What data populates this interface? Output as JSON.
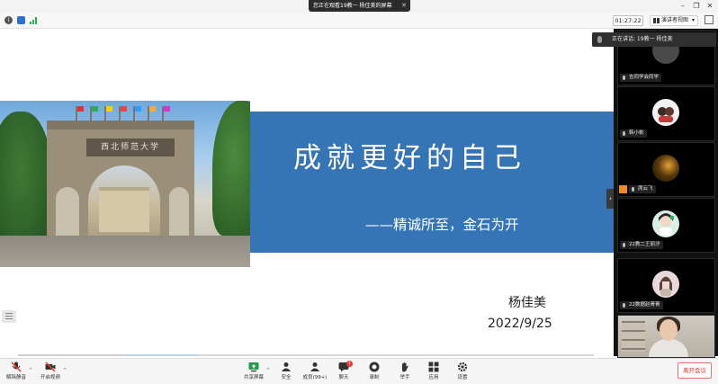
{
  "titlebar": {
    "viewing_label": "您正在观看19教一 杨佳美的屏幕",
    "close_glyph": "✕",
    "minimize_glyph": "–",
    "restore_glyph": "❐",
    "close_window_glyph": "✕"
  },
  "infobar": {
    "timer": "01:27:22",
    "view_button": "演讲者视图",
    "view_caret": "▾"
  },
  "slide": {
    "gate_plaque": "西北师范大学",
    "title": "成就更好的自己",
    "subtitle": "——精诚所至，金石为开",
    "presenter": "杨佳美",
    "date": "2022/9/25",
    "collapse_glyph": "›"
  },
  "right_panel": {
    "speaking_tip": "正在讲话: 19教一 杨佳美",
    "participants": [
      {
        "name": "吉同学会同学",
        "avatar_color": "#5a5a5a"
      },
      {
        "name": "韩小彬",
        "avatar_color": "#f2f2f2"
      },
      {
        "name": "席云飞",
        "avatar_color": "#3a2a10"
      },
      {
        "name": "22教二王丽汐",
        "avatar_color": "#dcefe4"
      },
      {
        "name": "22数据赵菁菁",
        "avatar_color": "#e7d8dc"
      }
    ]
  },
  "toolbar": {
    "mute_label": "解除静音",
    "video_label": "开启视频",
    "share_label": "共享屏幕",
    "security_label": "安全",
    "participants_label": "成员(99+)",
    "chat_label": "聊天",
    "chat_badge": "1",
    "record_label": "录制",
    "raise_hand_label": "举手",
    "apps_label": "应用",
    "settings_label": "设置",
    "leave_label": "离开会议",
    "caret_glyph": "^"
  },
  "colors": {
    "banner_blue": "#3574b5",
    "leave_red": "#d93b32",
    "panel_black": "#111111"
  }
}
